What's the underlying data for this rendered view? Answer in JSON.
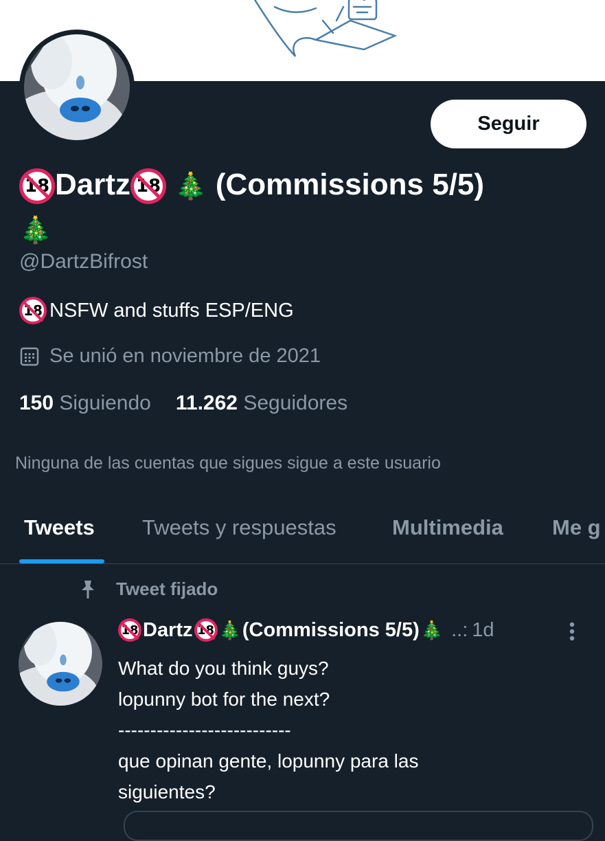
{
  "profile": {
    "follow_label": "Seguir",
    "name_text": "Dartz",
    "name_suffix": "(Commissions 5/5)",
    "badge_text": "18",
    "tree_emoji": "🎄",
    "handle": "@DartzBifrost",
    "bio": "NSFW and stuffs  ESP/ENG",
    "joined": "Se unió en noviembre de 2021",
    "following_count": "150",
    "following_label": "Siguiendo",
    "followers_count": "11.262",
    "followers_label": "Seguidores",
    "mutuals": "Ninguna de las cuentas que sigues sigue a este usuario"
  },
  "tabs": [
    {
      "label": "Tweets"
    },
    {
      "label": "Tweets y respuestas"
    },
    {
      "label": "Multimedia"
    },
    {
      "label": "Me g"
    }
  ],
  "pinned": {
    "label": "Tweet fijado"
  },
  "tweet": {
    "author_name": "Dartz",
    "author_suffix": "(Commissions 5/5)",
    "time_sep": "..:",
    "time": "1d",
    "body": "What do you think guys?\nlopunny bot for the next?\n---------------------------\nque opinan gente, lopunny para las\nsiguientes?"
  },
  "colors": {
    "background": "#15202b",
    "accent": "#1d9bf0",
    "muted_text": "#8b98a5",
    "badge_red": "#e0245e"
  },
  "icons": [
    "calendar-icon",
    "pin-icon",
    "more-vertical-icon",
    "no-under-18-icon",
    "christmas-tree-icon"
  ]
}
